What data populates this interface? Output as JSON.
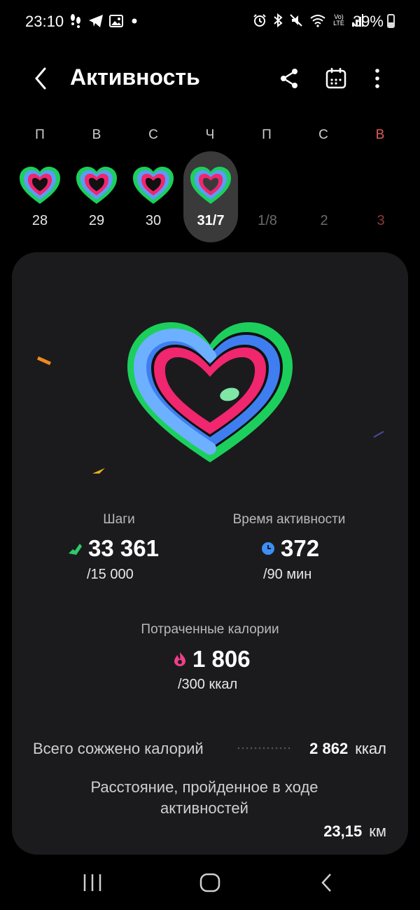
{
  "status_bar": {
    "time": "23:10",
    "battery": "39%",
    "battery_level": 0.39,
    "left_icons": [
      "steps-icon",
      "telegram-icon",
      "gallery-icon",
      "dot-icon"
    ],
    "right_icons": [
      "alarm-icon",
      "bluetooth-icon",
      "mute-icon",
      "wifi-icon",
      "volte-icon",
      "signal-icon"
    ],
    "volte_label": "Vo) LTE"
  },
  "header": {
    "title": "Активность",
    "back_icon": "back-icon",
    "share_icon": "share-icon",
    "calendar_icon": "calendar-icon",
    "more_icon": "more-vertical-icon"
  },
  "week": {
    "days": [
      {
        "letter": "П",
        "num": "28",
        "has_heart": true,
        "state": "past"
      },
      {
        "letter": "В",
        "num": "29",
        "has_heart": true,
        "state": "past"
      },
      {
        "letter": "С",
        "num": "30",
        "has_heart": true,
        "state": "past"
      },
      {
        "letter": "Ч",
        "num": "31/7",
        "has_heart": true,
        "state": "selected"
      },
      {
        "letter": "П",
        "num": "1/8",
        "has_heart": false,
        "state": "future"
      },
      {
        "letter": "С",
        "num": "2",
        "has_heart": false,
        "state": "future"
      },
      {
        "letter": "В",
        "num": "3",
        "has_heart": false,
        "state": "future-sunday"
      }
    ]
  },
  "summary": {
    "steps": {
      "label": "Шаги",
      "value": "33 361",
      "goal": "/15 000",
      "icon": "shoe-icon"
    },
    "active_time": {
      "label": "Время активности",
      "value": "372",
      "goal": "/90 мин",
      "icon": "clock-icon"
    },
    "calories": {
      "label": "Потраченные калории",
      "value": "1 806",
      "goal": "/300 ккал",
      "icon": "flame-icon"
    },
    "total_burned": {
      "label": "Всего сожжено калорий",
      "value": "2 862",
      "unit": "ккал"
    },
    "distance": {
      "label": "Расстояние, пройденное в ходе активностей",
      "value": "23,15",
      "unit": "км"
    }
  },
  "colors": {
    "ring_outer": "#1ccf5c",
    "ring_middle": "#5b9cf5",
    "ring_inner": "#f0266f",
    "accent_steps": "#2ec96a",
    "accent_time": "#3d8ef5",
    "accent_cal": "#ef3f8a",
    "sunday": "#e05a5a"
  },
  "nav": {
    "recents": "recents-icon",
    "home": "home-icon",
    "back": "nav-back-icon"
  }
}
